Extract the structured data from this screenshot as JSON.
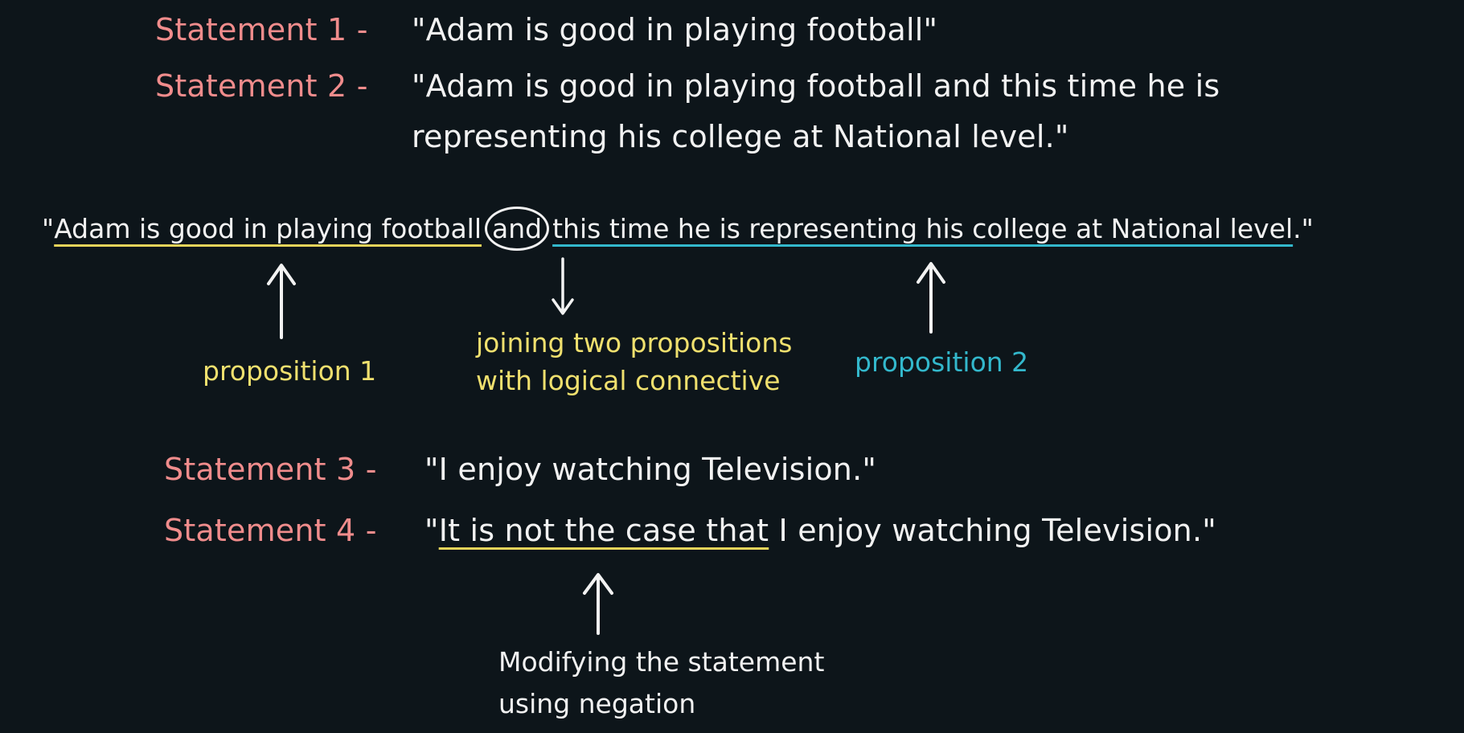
{
  "statements": [
    {
      "label": "Statement 1 -",
      "text": "\"Adam is good in playing football\""
    },
    {
      "label": "Statement 2 -",
      "text_line1": "\"Adam is good in playing football and this time he is",
      "text_line2": "representing his college at National level.\""
    },
    {
      "label": "Statement 3 -",
      "text": "\"I enjoy watching Television.\""
    },
    {
      "label": "Statement 4 -",
      "open_quote": "\"",
      "negation": "It is not the case that",
      "rest": " I enjoy watching Television.\""
    }
  ],
  "analysis": {
    "open_quote": "\"",
    "proposition_1": "Adam is good in playing football",
    "connective": "and",
    "proposition_2": "this time he is representing his college at National level",
    "close_quote": ".\""
  },
  "annotations": {
    "proposition_1": "proposition 1",
    "connective_line1": "joining two propositions",
    "connective_line2": "with logical connective",
    "proposition_2": "proposition 2",
    "negation_line1": "Modifying the statement",
    "negation_line2": "using negation"
  },
  "colors": {
    "background": "#0d151a",
    "statement_label": "#f08c8c",
    "text": "#f2f2f2",
    "proposition_1": "#f0e06e",
    "proposition_2": "#33b8cc"
  }
}
